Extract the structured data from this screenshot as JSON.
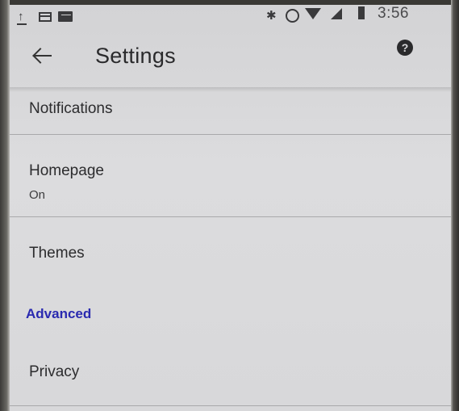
{
  "status_bar": {
    "time": "3:56",
    "icons": [
      "upload-icon",
      "browser-icon",
      "monitor-icon",
      "bluetooth-icon",
      "alarm-icon",
      "wifi-icon",
      "signal-icon",
      "battery-icon"
    ]
  },
  "app_bar": {
    "back_icon": "back-arrow-icon",
    "title": "Settings",
    "help_icon_glyph": "?"
  },
  "settings": {
    "notifications": {
      "title": "Notifications"
    },
    "homepage": {
      "title": "Homepage",
      "summary": "On"
    },
    "themes": {
      "title": "Themes"
    },
    "advanced_header": "Advanced",
    "privacy": {
      "title": "Privacy"
    }
  },
  "colors": {
    "accent": "#2a2ab0",
    "text": "#2c2c2e",
    "background": "#d8d8da"
  }
}
